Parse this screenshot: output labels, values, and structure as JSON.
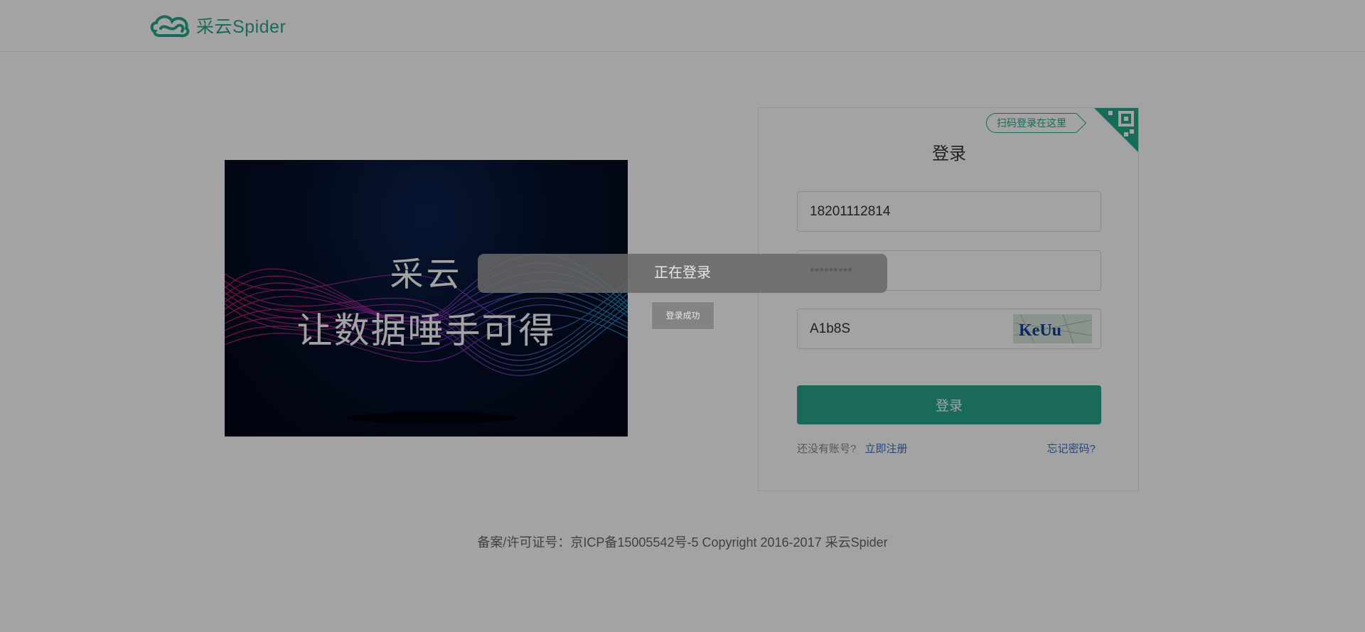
{
  "header": {
    "logo_text": "采云Spider",
    "logo_icon": "cloud-icon",
    "brand_color": "#2aa78e"
  },
  "banner": {
    "line1": "采云",
    "line2": "让数据唾手可得"
  },
  "login_panel": {
    "scan_tag": "扫码登录在这里",
    "title": "登录",
    "phone_value": "18201112814",
    "password_value": "•••••••••",
    "captcha_value": "A1b8S",
    "captcha_image_text": "KeUu",
    "submit_label": "登录",
    "no_account_text": "还没有账号?",
    "register_link": "立即注册",
    "forgot_link": "忘记密码?"
  },
  "footer": {
    "copyright": "备案/许可证号：京ICP备15005542号-5 Copyright 2016-2017 采云Spider"
  },
  "overlay": {
    "loading_text": "正在登录",
    "toast_text": "登录成功"
  }
}
